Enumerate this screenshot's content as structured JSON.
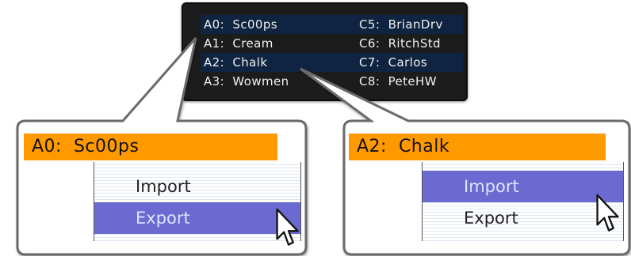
{
  "presets": {
    "rows": [
      {
        "left": "A0:  Sc00ps",
        "right": "C5:  BrianDrv"
      },
      {
        "left": "A1:  Cream",
        "right": "C6:  RitchStd"
      },
      {
        "left": "A2:  Chalk",
        "right": "C7:  Carlos"
      },
      {
        "left": "A3:  Wowmen",
        "right": "C8:  PeteHW"
      }
    ]
  },
  "callout_left": {
    "selected": "A0:  Sc00ps",
    "menu": [
      {
        "label": "Import",
        "highlighted": false
      },
      {
        "label": "Export",
        "highlighted": true
      }
    ]
  },
  "callout_right": {
    "selected": "A2:  Chalk",
    "menu": [
      {
        "label": "Import",
        "highlighted": true
      },
      {
        "label": "Export",
        "highlighted": false
      }
    ]
  },
  "colors": {
    "panel_bg": "#1c1c1c",
    "row_alt": "#0e2440",
    "selected_bar": "#ff9900",
    "menu_highlight": "#6a6ad0"
  },
  "icons": [
    "arrow-cursor-icon"
  ]
}
